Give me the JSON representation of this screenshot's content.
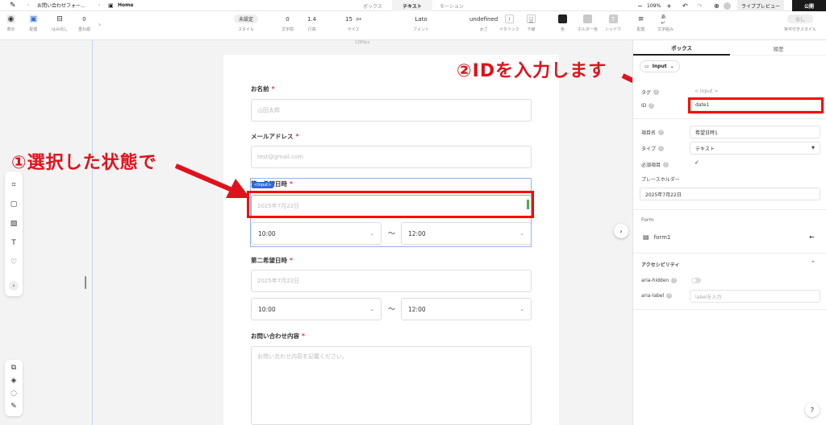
{
  "topbar": {
    "breadcrumb_page": "お問い合わせフォー...",
    "breadcrumb_home": "Home",
    "tabs": [
      "ボックス",
      "テキスト",
      "モーション"
    ],
    "zoom": "109%",
    "preview": "ライブプレビュー",
    "publish": "公開"
  },
  "toolbar": {
    "display": "表示",
    "placement": "配置",
    "overflow": "はみ出し",
    "overflow_value": "0",
    "stack": "重ね順",
    "style_value": "未設定",
    "style": "スタイル",
    "letter_value": "0",
    "letter": "文字間",
    "line_value": "1.4",
    "line": "行高",
    "size_value": "15",
    "size_unit": "px",
    "size": "サイズ",
    "font_value": "Lato",
    "font": "フォント",
    "weight_value": "undefined",
    "weight": "太さ",
    "italic": "イタリック",
    "underline": "下線",
    "color": "色",
    "holder_color": "ホルダー色",
    "shadow": "シャドウ",
    "align": "配置",
    "wrap": "文字組み",
    "cond_value": "なし",
    "cond": "条件付きスタイル"
  },
  "ruler": "1280px",
  "form": {
    "name_label": "お名前",
    "name_placeholder": "山田太郎",
    "email_label": "メールアドレス",
    "email_placeholder": "test@gmail.com",
    "first_date_label": "第一希望日時",
    "first_date_placeholder": "2025年7月22日",
    "first_time_start": "10:00",
    "first_time_end": "12:00",
    "second_date_label": "第二希望日時",
    "second_date_placeholder": "2025年7月22日",
    "second_time_start": "10:00",
    "second_time_end": "12:00",
    "content_label": "お問い合わせ内容",
    "content_placeholder": "お問い合わせ内容を記載ください。",
    "required_mark": "*",
    "tilde": "〜",
    "input_tag": "<Input>"
  },
  "annotations": {
    "step1": "①選択した状態で",
    "step2": "②IDを入力します"
  },
  "panel": {
    "tab_box": "ボックス",
    "tab_history": "履歴",
    "element_type": "Input",
    "tag_label": "タグ",
    "tag_value": "< input >",
    "id_label": "ID",
    "id_value": "date1",
    "item_name_label": "項目名",
    "item_name_value": "希望日時1",
    "type_label": "タイプ",
    "type_value": "テキスト",
    "required_label": "必須項目",
    "placeholder_label": "プレースホルダー",
    "placeholder_value": "2025年7月22日",
    "form_section": "Form",
    "form_name": "form1",
    "a11y_section": "アクセシビリティ",
    "aria_hidden_label": "aria-hidden",
    "aria_label_label": "aria-label",
    "aria_label_placeholder": "labelを入力"
  },
  "colors": {
    "annotation_red": "#e0111b",
    "selection_blue": "#2f6bd8",
    "required_red": "#e33333"
  }
}
